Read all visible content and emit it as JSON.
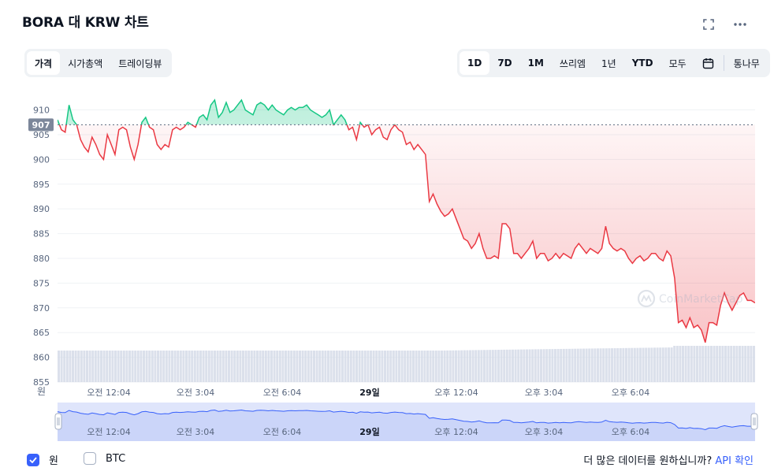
{
  "header": {
    "title": "BORA 대 KRW 차트"
  },
  "icons": {
    "fullscreen": "fullscreen-icon",
    "more": "more-horizontal-icon",
    "calendar": "calendar-icon",
    "watermark": "coinmarketcap-logo-icon"
  },
  "tabs": {
    "metric": [
      "가격",
      "시가총액",
      "트레이딩뷰"
    ],
    "range": [
      "1D",
      "7D",
      "1M",
      "쓰리엠",
      "1년",
      "YTD",
      "모두"
    ],
    "log_label": "통나무"
  },
  "watermark": "CoinMarketCap",
  "legend": {
    "primary": "원",
    "secondary": "BTC"
  },
  "footer": {
    "prefix": "더 많은 데이터를 원하십니까?",
    "link": "API 확인"
  },
  "colors": {
    "up": "#16c784",
    "down": "#ea3943",
    "accent": "#3861fb",
    "volume": "#cfd6e4"
  },
  "chart_data": {
    "type": "line",
    "y_axis_label": "원",
    "ylim": [
      855,
      912
    ],
    "yticks": [
      910,
      905,
      900,
      895,
      890,
      885,
      880,
      875,
      870,
      865,
      860,
      855
    ],
    "reference_price": 907,
    "reference_label": "907",
    "x_ticks": [
      "오전 12:04",
      "오전 3:04",
      "오전 6:04",
      "29일",
      "오후 12:04",
      "오후 3:04",
      "오후 6:04"
    ],
    "grid": "horizontal",
    "series": [
      {
        "values": [
          908,
          906,
          905.5,
          911,
          908,
          907,
          904,
          902.5,
          901.5,
          904.5,
          903,
          901,
          900,
          905,
          903,
          901,
          906,
          906.5,
          906,
          902.5,
          900,
          903,
          907.5,
          908.5,
          906.5,
          906,
          903,
          902,
          903,
          902.5,
          906,
          906.5,
          906,
          906.5,
          907.5,
          907,
          906.5,
          908.5,
          909,
          908,
          911,
          912,
          908.5,
          909.5,
          911.5,
          909.5,
          910,
          911,
          912,
          910,
          909.5,
          909,
          911,
          911.5,
          911,
          910,
          911,
          910,
          909.5,
          909,
          910,
          910.5,
          910,
          910.5,
          910.5,
          911,
          910,
          909.5,
          909,
          908.5,
          909,
          910,
          907,
          908,
          909,
          908,
          906,
          906.5,
          904,
          907.5,
          906.5,
          907,
          905,
          906,
          906.5,
          904.5,
          904,
          906,
          907,
          906,
          905.5,
          903,
          903.5,
          902,
          903,
          902,
          901,
          891.5,
          893,
          891,
          889.5,
          888.5,
          889,
          890,
          888,
          886,
          884,
          883.5,
          882,
          883,
          885,
          882,
          880,
          880,
          880.5,
          880,
          887,
          887,
          886,
          881,
          881,
          880,
          881,
          882,
          883.5,
          880,
          881,
          881,
          879.5,
          880,
          881,
          880,
          881,
          880.5,
          880,
          882,
          883,
          882,
          881,
          882,
          881.5,
          881,
          882,
          886.5,
          883,
          882,
          881.5,
          882,
          881.5,
          880,
          879,
          880,
          880.5,
          879.5,
          880,
          881,
          881,
          880,
          879.5,
          881.5,
          880.5,
          876,
          867,
          867.5,
          866,
          868,
          866,
          866.5,
          865.5,
          863,
          867,
          867,
          866.5,
          870.5,
          873,
          871,
          869.5,
          871,
          872.5,
          873,
          871.5,
          871.5,
          871
        ]
      }
    ]
  }
}
